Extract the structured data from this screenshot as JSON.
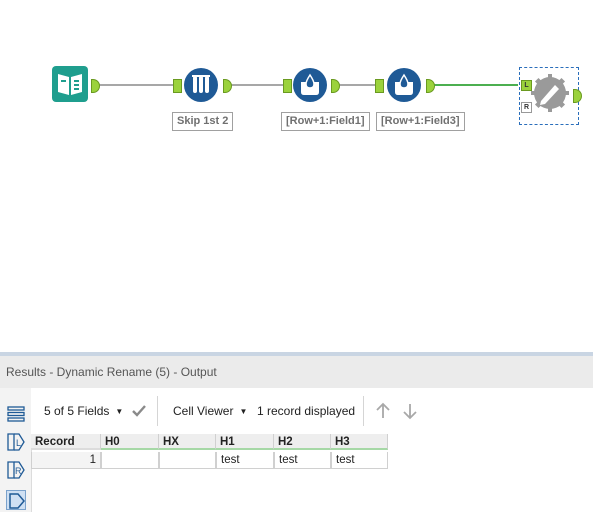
{
  "workflow": {
    "tools": [
      {
        "name": "input",
        "annotation": ""
      },
      {
        "name": "sample",
        "annotation": "Skip 1st 2"
      },
      {
        "name": "formula-1",
        "annotation": "[Row+1:Field1]"
      },
      {
        "name": "formula-2",
        "annotation": "[Row+1:Field3]"
      },
      {
        "name": "dynamic-rename",
        "anchor_left": "L",
        "anchor_right": "R"
      }
    ],
    "colors": {
      "tool_blue": "#1f5a96",
      "input_teal": "#1f9e8e",
      "anchor_green": "#9bd23c",
      "selected_connection": "#4caf50"
    }
  },
  "results": {
    "title": "Results - Dynamic Rename (5) - Output",
    "fields_label": "5 of 5 Fields",
    "viewer_label": "Cell Viewer",
    "record_count": "1 record displayed",
    "rail_icons": [
      "rows-icon",
      "left-anchor-L-icon",
      "right-anchor-R-icon",
      "output-anchor-icon"
    ],
    "rail_letters": {
      "l": "L",
      "r": "R"
    },
    "columns": [
      "Record",
      "H0",
      "HX",
      "H1",
      "H2",
      "H3"
    ],
    "rows": [
      [
        "1",
        "",
        "",
        "test",
        "test",
        "test"
      ]
    ]
  }
}
